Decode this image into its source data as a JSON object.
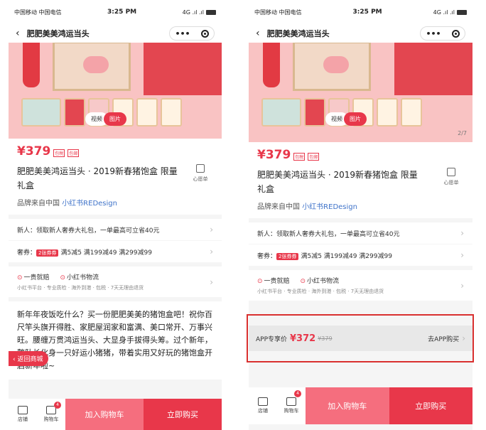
{
  "status": {
    "carrier": "中国移动  中国电信",
    "time": "3:25 PM",
    "signal": "4G .ıl .ıl",
    "battery": "69"
  },
  "nav": {
    "back": "‹",
    "title": "肥肥美美鸿运当头",
    "more": "•••"
  },
  "media": {
    "video": "视频",
    "image": "图片",
    "page_left": "",
    "page_right": "2/7"
  },
  "product": {
    "price": "¥379",
    "tags": [
      "包税",
      "包邮"
    ],
    "title": "肥肥美美鸿运当头 · 2019新春猪饱盒 限量礼盒",
    "fav_label": "心愿单",
    "brand_prefix": "品牌来自中国",
    "brand_link": "小红书REDesign"
  },
  "rows": {
    "newcomer": "新人：领取新人奢券大礼包，一单最高可立省40元",
    "coupon_label": "奢券：",
    "coupon_tag": "2张券券",
    "coupon_text": "满5减5 满199减49 满299减99"
  },
  "service": {
    "item1": "一贵就赔",
    "item2": "小红书物流",
    "sub": "小红书平台 · 专业质检 · 海外到港 · 包税 · 7天无理由退货"
  },
  "desc": "新年年夜饭吃什么？买一份肥肥美美的猪饱盒吧！祝你百尺竿头旗开得胜、家肥屋润家和富满、美口常开、万事兴旺。腰缠万贯鸿运当头、大显身手拔得头筹。过个新年，整队长化身一只好运小猪猪，带着实用又好玩的猪饱盒开启新年啦~",
  "back_mall": "‹ 返回商城",
  "app_bar": {
    "label": "APP专享价",
    "price": "¥372",
    "old": "¥379",
    "go": "去APP购买",
    "chev": "›"
  },
  "bottom": {
    "store": "店铺",
    "cart": "购物车",
    "cart_badge": "4",
    "add_cart": "加入购物车",
    "buy_now": "立即购买"
  },
  "icons": {
    "chevron": "›",
    "check": "⊙"
  }
}
